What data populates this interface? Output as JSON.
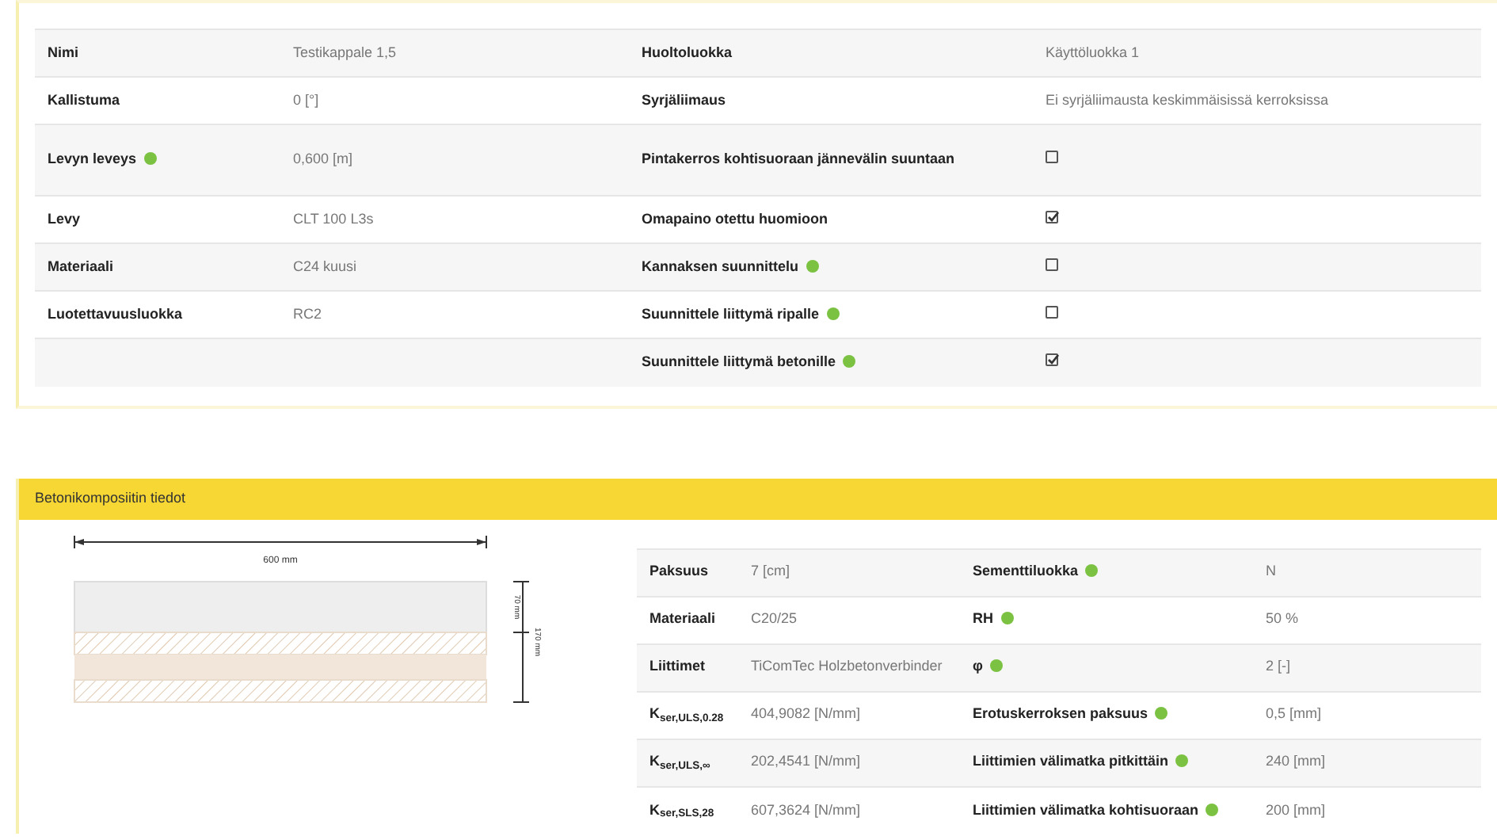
{
  "properties": {
    "rows": [
      {
        "label": "Nimi",
        "value": "Testikappale 1,5",
        "info": false,
        "label2": "Huoltoluokka",
        "kind": "text",
        "value2": "Käyttöluokka 1",
        "info2": false
      },
      {
        "label": "Kallistuma",
        "value": "0 [°]",
        "info": false,
        "label2": "Syrjäliimaus",
        "kind": "text",
        "value2": "Ei syrjäliimausta keskimmäisissä kerroksissa",
        "info2": false
      },
      {
        "label": "Levyn leveys",
        "value": "0,600 [m]",
        "info": true,
        "label2": "Pintakerros kohtisuoraan jännevälin suuntaan",
        "kind": "check",
        "checked": false,
        "info2": false
      },
      {
        "label": "Levy",
        "value": "CLT 100 L3s",
        "info": false,
        "label2": "Omapaino otettu huomioon",
        "kind": "check",
        "checked": true,
        "info2": false
      },
      {
        "label": "Materiaali",
        "value": "C24 kuusi",
        "info": false,
        "label2": "Kannaksen suunnittelu",
        "kind": "check",
        "checked": false,
        "info2": true
      },
      {
        "label": "Luotettavuusluokka",
        "value": "RC2",
        "info": false,
        "label2": "Suunnittele liittymä ripalle",
        "kind": "check",
        "checked": false,
        "info2": true
      },
      {
        "label2": "Suunnittele liittymä betonille",
        "kind": "check",
        "checked": true,
        "info2": true
      }
    ]
  },
  "composite": {
    "title": "Betonikomposiitin tiedot",
    "drawing": {
      "width_label": "600 mm",
      "top_label": "70 mm",
      "total_label": "170 mm"
    },
    "rows": [
      {
        "label": "Paksuus",
        "value": "7 [cm]",
        "label2": "Sementtiluokka",
        "info2": true,
        "value2": "N"
      },
      {
        "label": "Materiaali",
        "value": "C20/25",
        "label2": "RH",
        "info2": true,
        "value2": "50 %"
      },
      {
        "label": "Liittimet",
        "value": "TiComTec Holzbetonverbinder",
        "label2": "φ",
        "info2": true,
        "value2": "2 [-]"
      },
      {
        "label": "K$_{ser,ULS,0.28}$",
        "value": "404,9082 [N/mm]",
        "label2": "Erotuskerroksen paksuus",
        "info2": true,
        "value2": "0,5 [mm]"
      },
      {
        "label": "K$_{ser,ULS,∞}$",
        "value": "202,4541 [N/mm]",
        "label2": "Liittimien välimatka pitkittäin",
        "info2": true,
        "value2": "240 [mm]"
      },
      {
        "label": "K$_{ser,SLS,28}$",
        "value": "607,3624 [N/mm]",
        "label2": "Liittimien välimatka kohtisuoraan",
        "info2": true,
        "value2": "200 [mm]"
      }
    ]
  }
}
